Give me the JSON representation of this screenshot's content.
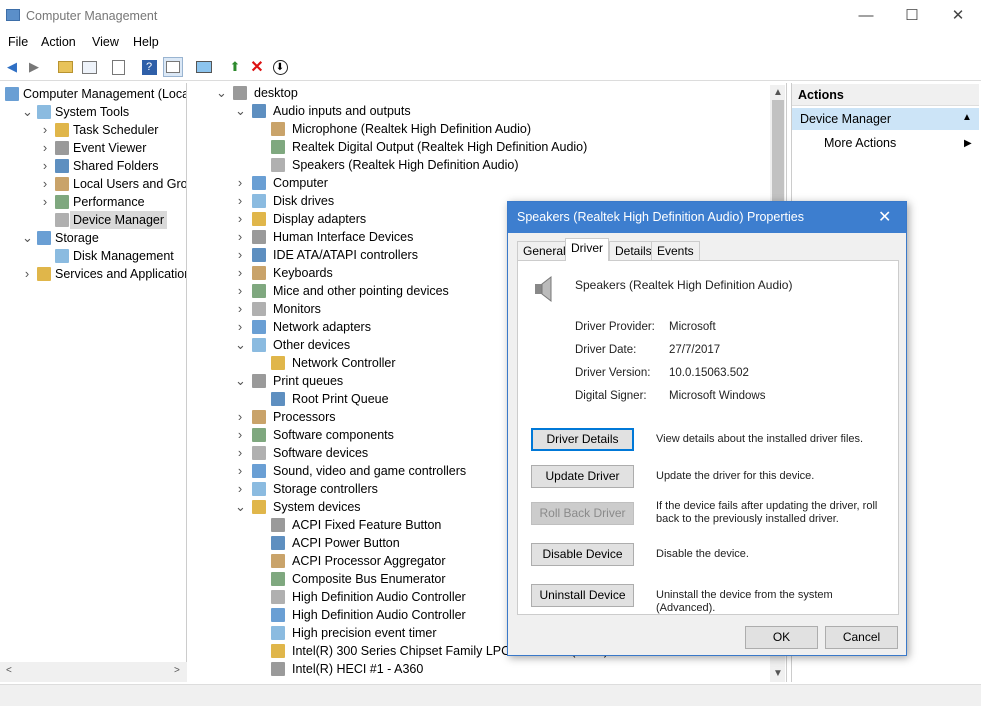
{
  "window": {
    "title": "Computer Management",
    "min": "—",
    "max": "☐",
    "close": "✕"
  },
  "menu": [
    "File",
    "Action",
    "View",
    "Help"
  ],
  "left_tree": [
    {
      "label": "Computer Management (Local",
      "level": 0,
      "exp": ""
    },
    {
      "label": "System Tools",
      "level": 1,
      "exp": "v"
    },
    {
      "label": "Task Scheduler",
      "level": 2,
      "exp": ">"
    },
    {
      "label": "Event Viewer",
      "level": 2,
      "exp": ">"
    },
    {
      "label": "Shared Folders",
      "level": 2,
      "exp": ">"
    },
    {
      "label": "Local Users and Groups",
      "level": 2,
      "exp": ">"
    },
    {
      "label": "Performance",
      "level": 2,
      "exp": ">"
    },
    {
      "label": "Device Manager",
      "level": 2,
      "exp": "",
      "selected": true
    },
    {
      "label": "Storage",
      "level": 1,
      "exp": "v"
    },
    {
      "label": "Disk Management",
      "level": 2,
      "exp": ""
    },
    {
      "label": "Services and Applications",
      "level": 1,
      "exp": ">"
    }
  ],
  "device_tree": [
    {
      "label": "desktop",
      "level": 0,
      "exp": "v"
    },
    {
      "label": "Audio inputs and outputs",
      "level": 1,
      "exp": "v"
    },
    {
      "label": "Microphone (Realtek High Definition Audio)",
      "level": 2,
      "exp": ""
    },
    {
      "label": "Realtek Digital Output (Realtek High Definition Audio)",
      "level": 2,
      "exp": ""
    },
    {
      "label": "Speakers (Realtek High Definition Audio)",
      "level": 2,
      "exp": ""
    },
    {
      "label": "Computer",
      "level": 1,
      "exp": ">"
    },
    {
      "label": "Disk drives",
      "level": 1,
      "exp": ">"
    },
    {
      "label": "Display adapters",
      "level": 1,
      "exp": ">"
    },
    {
      "label": "Human Interface Devices",
      "level": 1,
      "exp": ">"
    },
    {
      "label": "IDE ATA/ATAPI controllers",
      "level": 1,
      "exp": ">"
    },
    {
      "label": "Keyboards",
      "level": 1,
      "exp": ">"
    },
    {
      "label": "Mice and other pointing devices",
      "level": 1,
      "exp": ">"
    },
    {
      "label": "Monitors",
      "level": 1,
      "exp": ">"
    },
    {
      "label": "Network adapters",
      "level": 1,
      "exp": ">"
    },
    {
      "label": "Other devices",
      "level": 1,
      "exp": "v"
    },
    {
      "label": "Network Controller",
      "level": 2,
      "exp": ""
    },
    {
      "label": "Print queues",
      "level": 1,
      "exp": "v"
    },
    {
      "label": "Root Print Queue",
      "level": 2,
      "exp": ""
    },
    {
      "label": "Processors",
      "level": 1,
      "exp": ">"
    },
    {
      "label": "Software components",
      "level": 1,
      "exp": ">"
    },
    {
      "label": "Software devices",
      "level": 1,
      "exp": ">"
    },
    {
      "label": "Sound, video and game controllers",
      "level": 1,
      "exp": ">"
    },
    {
      "label": "Storage controllers",
      "level": 1,
      "exp": ">"
    },
    {
      "label": "System devices",
      "level": 1,
      "exp": "v"
    },
    {
      "label": "ACPI Fixed Feature Button",
      "level": 2,
      "exp": ""
    },
    {
      "label": "ACPI Power Button",
      "level": 2,
      "exp": ""
    },
    {
      "label": "ACPI Processor Aggregator",
      "level": 2,
      "exp": ""
    },
    {
      "label": "Composite Bus Enumerator",
      "level": 2,
      "exp": ""
    },
    {
      "label": "High Definition Audio Controller",
      "level": 2,
      "exp": ""
    },
    {
      "label": "High Definition Audio Controller",
      "level": 2,
      "exp": ""
    },
    {
      "label": "High precision event timer",
      "level": 2,
      "exp": ""
    },
    {
      "label": "Intel(R) 300 Series Chipset Family LPC Controller (Z370) - A305",
      "level": 2,
      "exp": ""
    },
    {
      "label": "Intel(R) HECI #1 - A360",
      "level": 2,
      "exp": ""
    }
  ],
  "actions": {
    "header": "Actions",
    "section": "Device Manager",
    "more": "More Actions"
  },
  "dialog": {
    "title": "Speakers (Realtek High Definition Audio) Properties",
    "tabs": [
      "General",
      "Driver",
      "Details",
      "Events"
    ],
    "device_name": "Speakers (Realtek High Definition Audio)",
    "fields": [
      {
        "label": "Driver Provider:",
        "value": "Microsoft"
      },
      {
        "label": "Driver Date:",
        "value": "27/7/2017"
      },
      {
        "label": "Driver Version:",
        "value": "10.0.15063.502"
      },
      {
        "label": "Digital Signer:",
        "value": "Microsoft Windows"
      }
    ],
    "buttons": [
      {
        "label": "Driver Details",
        "desc": "View details about the installed driver files."
      },
      {
        "label": "Update Driver",
        "desc": "Update the driver for this device."
      },
      {
        "label": "Roll Back Driver",
        "desc": "If the device fails after updating the driver, roll back to the previously installed driver."
      },
      {
        "label": "Disable Device",
        "desc": "Disable the device."
      },
      {
        "label": "Uninstall Device",
        "desc": "Uninstall the device from the system (Advanced)."
      }
    ],
    "ok": "OK",
    "cancel": "Cancel"
  }
}
